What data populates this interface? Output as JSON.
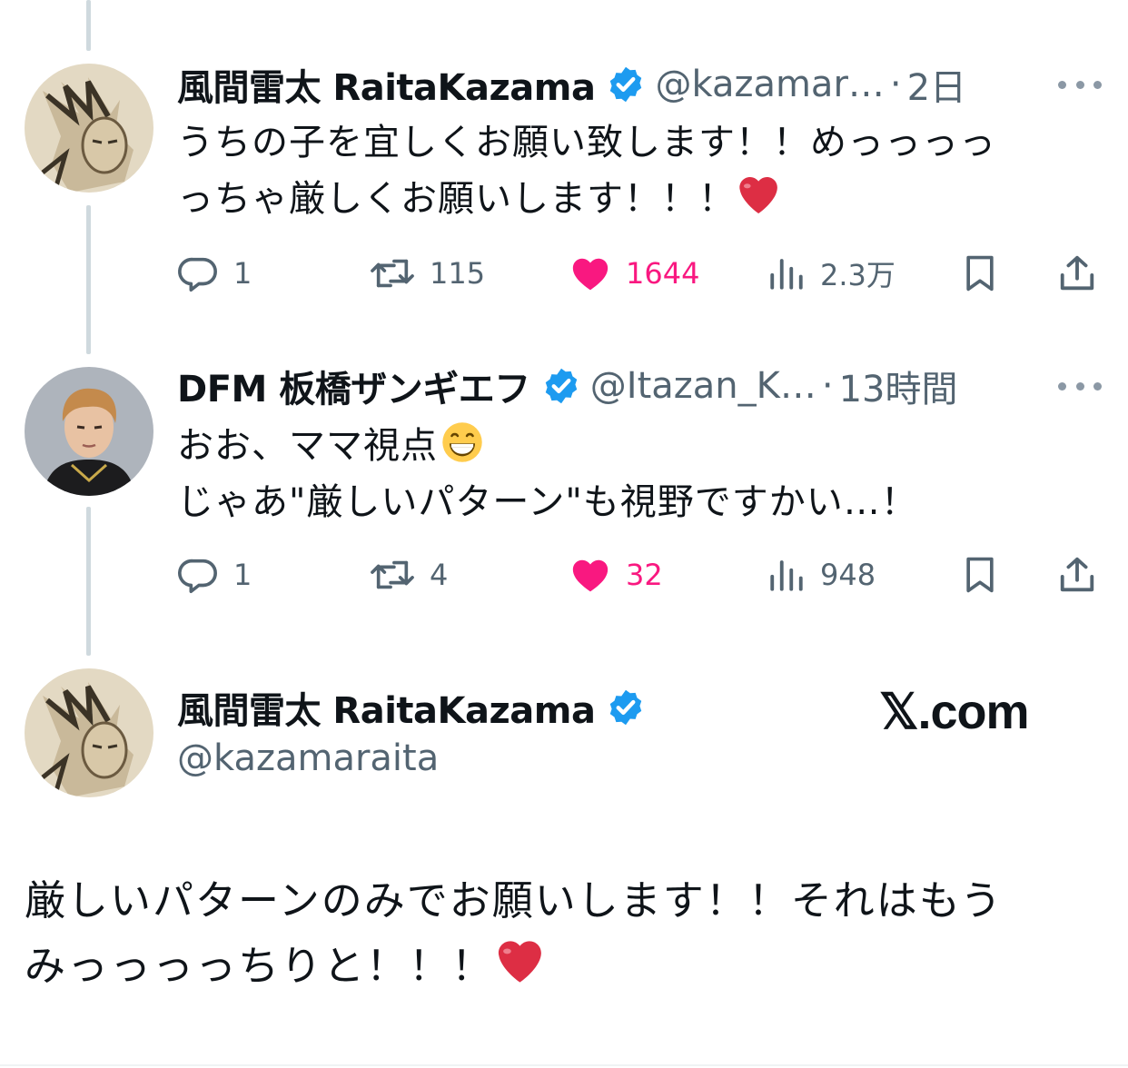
{
  "tweets": [
    {
      "name": "風間雷太 RaitaKazama",
      "handle": "@kazamar…",
      "separator": "·",
      "time": "2日",
      "text_lines": [
        "うちの子を宜しくお願い致します！！めっっっっ",
        "っちゃ厳しくお願いします！！！"
      ],
      "emoji": "red-heart",
      "replies": "1",
      "reposts": "115",
      "likes": "1644",
      "views": "2.3万",
      "liked": true
    },
    {
      "name": "DFM 板橋ザンギエフ",
      "handle": "@Itazan_K…",
      "separator": "·",
      "time": "13時間",
      "text_lines": [
        "おお、ママ視点",
        "じゃあ\"厳しいパターン\"も視野ですかい…！"
      ],
      "emoji": "grinning-face",
      "replies": "1",
      "reposts": "4",
      "likes": "32",
      "views": "948",
      "liked": true
    }
  ],
  "main_tweet": {
    "name": "風間雷太 RaitaKazama",
    "handle": "@kazamaraita",
    "watermark": "𝕏.com",
    "text_lines": [
      "厳しいパターンのみでお願いします！！それはもう",
      "みっっっっちりと！！！"
    ],
    "emoji": "red-heart"
  },
  "colors": {
    "text": "#0f1419",
    "secondary": "#536471",
    "like": "#f91880",
    "verified": "#1d9bf0",
    "thread_line": "#cfd9de"
  }
}
